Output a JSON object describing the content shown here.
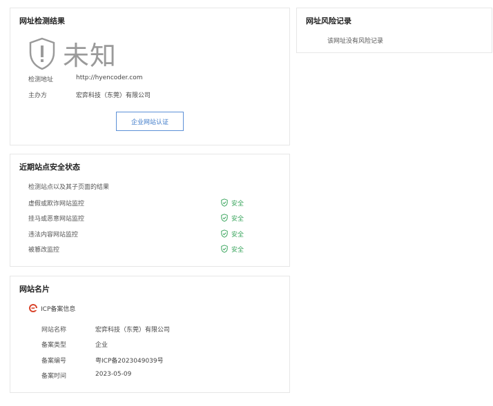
{
  "detection": {
    "title": "网址检测结果",
    "status": "未知",
    "fields": [
      {
        "label": "检测地址",
        "value": "http://hyencoder.com"
      },
      {
        "label": "主办方",
        "value": "宏弈科技（东莞）有限公司"
      }
    ],
    "cert_button": "企业网站认证"
  },
  "risk": {
    "title": "网址风险记录",
    "empty_text": "该网址没有风险记录"
  },
  "security": {
    "title": "近期站点安全状态",
    "subtitle": "检测站点以及其子页面的结果",
    "items": [
      {
        "label": "虚假或欺诈网站监控",
        "status": "安全"
      },
      {
        "label": "挂马或恶意网站监控",
        "status": "安全"
      },
      {
        "label": "违法内容网站监控",
        "status": "安全"
      },
      {
        "label": "被篡改监控",
        "status": "安全"
      }
    ]
  },
  "card": {
    "title": "网站名片",
    "icp_title": "ICP备案信息",
    "fields": [
      {
        "label": "网站名称",
        "value": "宏弈科技（东莞）有限公司"
      },
      {
        "label": "备案类型",
        "value": "企业"
      },
      {
        "label": "备案编号",
        "value": "粤ICP备2023049039号"
      },
      {
        "label": "备案时间",
        "value": "2023-05-09"
      }
    ]
  },
  "colors": {
    "safe": "#3aa55d",
    "link": "#3b78c8",
    "unknown": "#9a9a9a"
  }
}
